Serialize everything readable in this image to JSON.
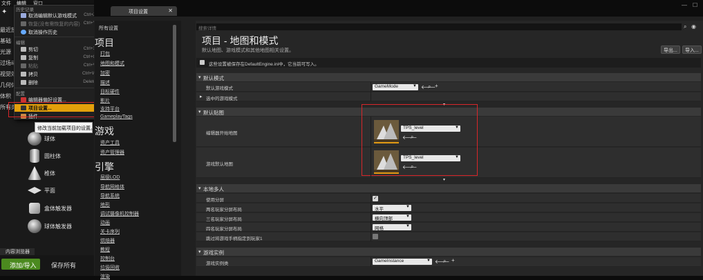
{
  "editor_menubar": {
    "file": "文件",
    "edit": "编辑",
    "window": "窗口"
  },
  "left_modes": [
    "最近放",
    "基础",
    "光源",
    "过场动",
    "视觉效",
    "几何体",
    "体积",
    "所有类"
  ],
  "edit_menu": {
    "history_header": "历史记录",
    "items_history": [
      {
        "label": "取消编辑默认游戏模式",
        "shortcut": "Ctrl+Z"
      },
      {
        "label": "恢复(没有需恢复的内容)",
        "shortcut": "Ctrl+Y"
      },
      {
        "label": "取消操作历史",
        "shortcut": ""
      }
    ],
    "edit_header": "编辑",
    "items_edit": [
      {
        "label": "剪切",
        "shortcut": "Ctrl+X"
      },
      {
        "label": "复制",
        "shortcut": "Ctrl+C"
      },
      {
        "label": "粘贴",
        "shortcut": "Ctrl+V"
      },
      {
        "label": "拷贝",
        "shortcut": "Ctrl+W"
      },
      {
        "label": "删除",
        "shortcut": "Delete"
      }
    ],
    "config_header": "配置",
    "items_config": [
      {
        "label": "编辑器偏好设置..."
      },
      {
        "label": "项目设置..."
      },
      {
        "label": "插件"
      }
    ]
  },
  "tooltip": "修改当前加载项目的设置。",
  "shapes": [
    "球体",
    "圆柱体",
    "椎体",
    "平面",
    "盒体触发器",
    "球体触发器"
  ],
  "content_browser": {
    "tab": "内容浏览器",
    "add_import": "添加/导入",
    "save_all": "保存所有"
  },
  "window_tab": "项目设置",
  "categories": {
    "all": "所有设置",
    "project_header": "项目",
    "project_items": [
      "打包",
      "地图和模式",
      "加密",
      "描述",
      "目标硬件",
      "影片",
      "支持平台",
      "GameplayTags"
    ],
    "game_header": "游戏",
    "game_items": [
      "资产工具",
      "资产管理器"
    ],
    "engine_header": "引擎",
    "engine_items": [
      "层级LOD",
      "导航网格体",
      "导航系统",
      "地形",
      "调试摄像机控制器",
      "动画",
      "关卡序列",
      "烘焙器",
      "教程",
      "控制台",
      "垃圾回收",
      "渲染"
    ]
  },
  "details": {
    "search_placeholder": "搜索详情",
    "title": "项目 - 地图和模式",
    "subtitle": "默认地图、游戏模式和其他地图相关设置。",
    "export_btn": "导出...",
    "import_btn": "导入...",
    "notice": "这些设置被保存在DefaultEngine.ini中，它当前可写入。",
    "default_modes": {
      "header": "默认模式",
      "default_game_mode_label": "默认游戏模式",
      "default_game_mode_value": "GameMode",
      "selected_game_mode_label": "选中的游戏模式"
    },
    "default_maps": {
      "header": "默认贴图",
      "editor_startup_label": "编辑器开始地图",
      "editor_startup_value": "TPS_level",
      "game_default_label": "游戏默认地图",
      "game_default_value": "TPS_level"
    },
    "local_multiplayer": {
      "header": "本地多人",
      "use_splitscreen_label": "使用分屏",
      "two_player_label": "两名玩家分屏布局",
      "two_player_value": "水平",
      "three_player_label": "三名玩家分屏布局",
      "three_player_value": "横向顶部",
      "four_player_label": "四名玩家分屏布局",
      "four_player_value": "网格",
      "skip_gamepad_label": "跳过将游戏手柄指定到玩家1"
    },
    "game_instance": {
      "header": "游戏实例",
      "class_label": "游戏实例类",
      "class_value": "GameInstance"
    }
  }
}
